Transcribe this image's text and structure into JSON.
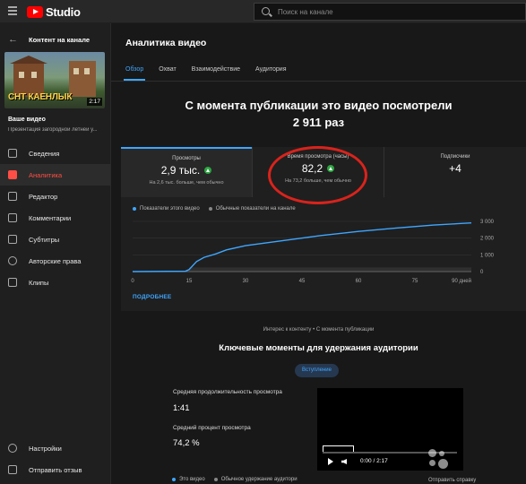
{
  "app": {
    "logo_text": "Studio"
  },
  "search": {
    "placeholder": "Поиск на канале"
  },
  "sidebar": {
    "back_label": "Контент на канале",
    "thumbnail_text": "СНТ КАЕНЛЫК",
    "duration": "2:17",
    "your_video": "Ваше видео",
    "video_title": "Презентация загородной летней у...",
    "items": [
      {
        "label": "Сведения",
        "icon": "pencil-icon",
        "active": false
      },
      {
        "label": "Аналитика",
        "icon": "analytics-icon",
        "active": true
      },
      {
        "label": "Редактор",
        "icon": "editor-icon",
        "active": false
      },
      {
        "label": "Комментарии",
        "icon": "comments-icon",
        "active": false
      },
      {
        "label": "Субтитры",
        "icon": "subtitles-icon",
        "active": false
      },
      {
        "label": "Авторские права",
        "icon": "copyright-icon",
        "active": false
      },
      {
        "label": "Клипы",
        "icon": "clips-icon",
        "active": false
      }
    ],
    "bottom_items": [
      {
        "label": "Настройки",
        "icon": "gear-icon"
      },
      {
        "label": "Отправить отзыв",
        "icon": "feedback-icon"
      }
    ]
  },
  "main": {
    "page_title": "Аналитика видео",
    "tabs": [
      {
        "label": "Обзор",
        "active": true
      },
      {
        "label": "Охват",
        "active": false
      },
      {
        "label": "Взаимодействие",
        "active": false
      },
      {
        "label": "Аудитория",
        "active": false
      }
    ],
    "headline_line1": "С момента публикации это видео посмотрели",
    "headline_line2": "2 911 раз",
    "stats": [
      {
        "label": "Просмотры",
        "value": "2,9 тыс.",
        "note": "На 2,6 тыс. больше, чем обычно"
      },
      {
        "label": "Время просмотра (часы)",
        "value": "82,2",
        "note": "На 73,2 больше, чем обычно"
      },
      {
        "label": "Подписчики",
        "value": "+4",
        "note": ""
      }
    ],
    "legend": {
      "this_video": "Показатели этого видео",
      "typical": "Обычные показатели на канале"
    },
    "more_link": "ПОДРОБНЕЕ",
    "interest_label": "Интерес к контенту • С момента публикации",
    "moments_title": "Ключевые моменты для удержания аудитории",
    "chip_label": "Вступление",
    "avg_duration_label": "Средняя продолжительность просмотра",
    "avg_duration_value": "1:41",
    "avg_percent_label": "Средний процент просмотра",
    "avg_percent_value": "74,2 %",
    "player_time": "0:00 / 2:17",
    "bottom_legend": {
      "this_video": "Это видео",
      "typical": "Обычное удержание аудитори"
    },
    "help_link": "Отправить справку"
  },
  "colors": {
    "accent": "#3ea6ff",
    "brand": "#ff0000",
    "active_nav": "#ff4e45",
    "up": "#2ba640",
    "highlight_ring": "#d9231c"
  },
  "chart_data": {
    "type": "line",
    "x_ticks": [
      "0",
      "15",
      "30",
      "45",
      "60",
      "75",
      "90 дней"
    ],
    "y_ticks": [
      "0",
      "1 000",
      "2 000",
      "3 000"
    ],
    "ylim": [
      0,
      3000
    ],
    "series": [
      {
        "name": "Показатели этого видео",
        "color": "#3ea6ff",
        "x": [
          0,
          14,
          15,
          17,
          19,
          22,
          25,
          30,
          40,
          50,
          60,
          70,
          80,
          90
        ],
        "y": [
          0,
          20,
          120,
          600,
          850,
          1050,
          1300,
          1550,
          1850,
          2150,
          2400,
          2600,
          2780,
          2911
        ]
      },
      {
        "name": "Обычные показатели на канале",
        "color": "#666666",
        "x": [
          0,
          15,
          30,
          45,
          60,
          75,
          90
        ],
        "y": [
          0,
          0,
          0,
          0,
          0,
          0,
          0
        ]
      }
    ]
  }
}
